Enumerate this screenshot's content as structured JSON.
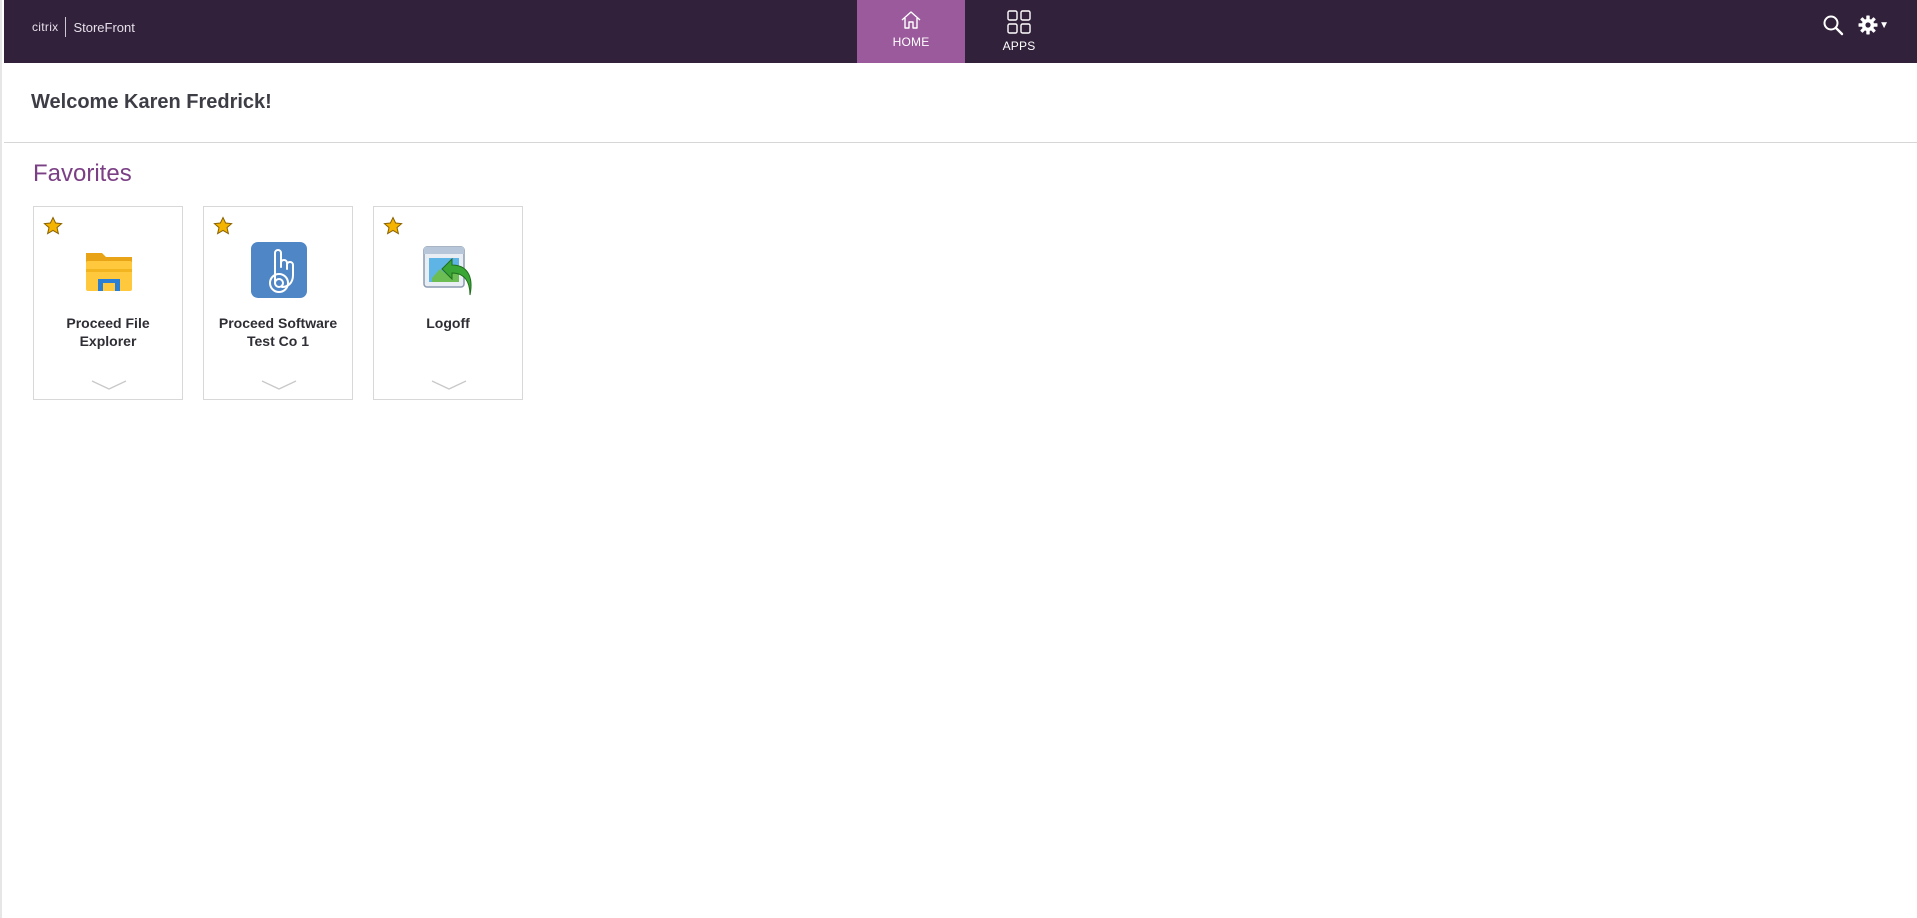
{
  "brand": {
    "company": "citrix",
    "product": "StoreFront"
  },
  "nav": {
    "tabs": [
      {
        "label": "HOME",
        "icon": "home-icon",
        "active": true
      },
      {
        "label": "APPS",
        "icon": "apps-grid-icon",
        "active": false
      }
    ]
  },
  "tools": {
    "search_icon": "search-icon",
    "settings_icon": "gear-icon"
  },
  "welcome": {
    "text": "Welcome Karen Fredrick!"
  },
  "favorites": {
    "title": "Favorites",
    "apps": [
      {
        "name": "Proceed File Explorer",
        "icon": "folder-icon",
        "favorite": true
      },
      {
        "name": "Proceed Software Test Co 1",
        "icon": "touch-hand-icon",
        "favorite": true
      },
      {
        "name": "Logoff",
        "icon": "logoff-icon",
        "favorite": true
      }
    ]
  },
  "colors": {
    "header_bg": "#32213b",
    "active_tab_bg": "#9a5a9c",
    "section_title": "#7b3f85",
    "star": "#f4b400"
  }
}
